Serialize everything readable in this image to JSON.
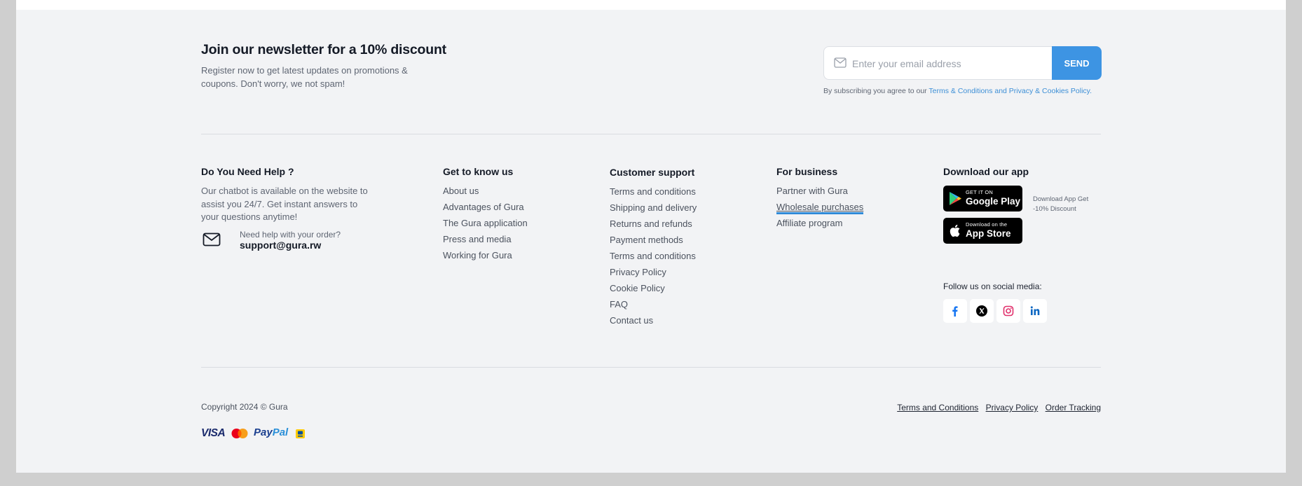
{
  "newsletter": {
    "title": "Join our newsletter for a 10% discount",
    "description": "Register now to get latest updates on promotions & coupons. Don't worry, we not spam!",
    "email_placeholder": "Enter your email address",
    "send_label": "SEND",
    "terms_prefix": "By subscribing you agree to our",
    "terms_link": "Terms & Conditions and Privacy & Cookies Policy."
  },
  "help": {
    "title": "Do You Need Help ?",
    "description": "Our chatbot is available on the website to assist you 24/7. Get instant answers to your questions anytime!",
    "question": "Need help with your order?",
    "email": "support@gura.rw"
  },
  "columns": [
    {
      "title": "Get to know us",
      "items": [
        "About us",
        "Advantages of Gura",
        "The Gura application",
        "Press and media",
        "Working for Gura"
      ]
    },
    {
      "title": "Customer support",
      "items": [
        "Terms and conditions",
        "Shipping and delivery",
        "Returns and refunds",
        "Payment methods",
        "Terms and conditions",
        "Privacy Policy",
        "Cookie Policy",
        "FAQ",
        "Contact us"
      ]
    },
    {
      "title": "For business",
      "items": [
        "Partner with Gura",
        "Wholesale purchases",
        "Affiliate program"
      ],
      "active_index": 1
    }
  ],
  "app": {
    "title": "Download our app",
    "google_small": "GET IT ON",
    "google_big": "Google Play",
    "apple_small": "Download on the",
    "apple_big": "App Store",
    "note": "Download App Get -10% Discount",
    "follow": "Follow us on social media:",
    "socials": [
      "facebook-icon",
      "x-twitter-icon",
      "instagram-icon",
      "linkedin-icon"
    ]
  },
  "footer": {
    "copyright": "Copyright 2024 © Gura",
    "links": [
      "Terms and Conditions",
      "Privacy Policy",
      "Order Tracking"
    ],
    "payments": {
      "visa": "VISA",
      "paypal_a": "Pay",
      "paypal_b": "Pal",
      "methods": [
        "visa-icon",
        "mastercard-icon",
        "paypal-icon",
        "mobile-money-icon"
      ]
    }
  },
  "colors": {
    "accent": "#3d94e3",
    "link": "#3d8fd6",
    "background": "#f2f3f5"
  }
}
